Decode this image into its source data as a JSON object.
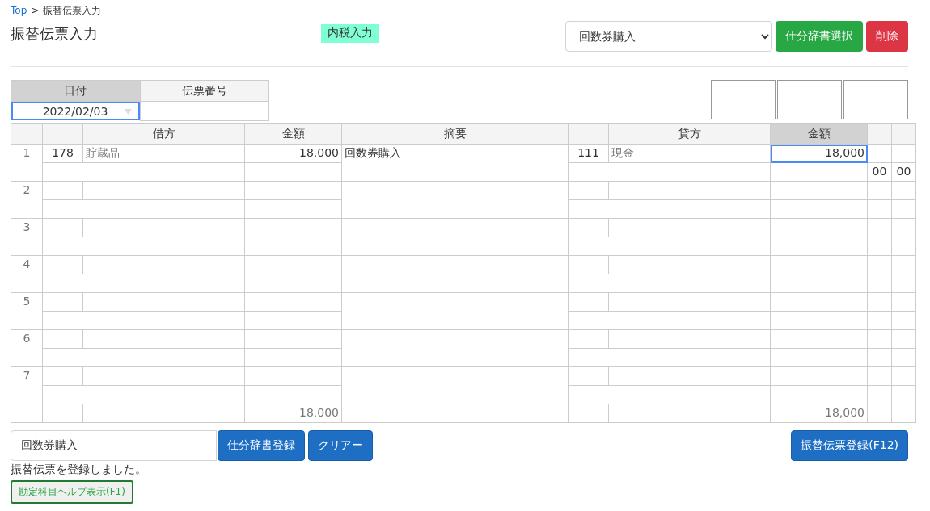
{
  "breadcrumb": {
    "link": "Top",
    "separator": ">",
    "current": "振替伝票入力"
  },
  "title": "振替伝票入力",
  "tax_badge": "内税入力",
  "dictionary_select": {
    "value": "回数券購入"
  },
  "header_buttons": [
    {
      "label": "仕分辞書選択",
      "kind": "success"
    },
    {
      "label": "削除",
      "kind": "danger"
    }
  ],
  "voucher_header": {
    "columns": [
      {
        "label": "日付",
        "highlighted": true
      },
      {
        "label": "伝票番号",
        "highlighted": false
      }
    ],
    "date": {
      "value": "2022/02/03",
      "focused": true
    }
  },
  "table": {
    "columns": [
      {
        "highlighted": false
      },
      {
        "highlighted": false
      },
      {
        "label": "借方",
        "highlighted": false
      },
      {
        "label": "金額",
        "highlighted": false
      },
      {
        "label": "摘要",
        "highlighted": false
      },
      {
        "highlighted": false
      },
      {
        "label": "貸方",
        "highlighted": false
      },
      {
        "label": "金額",
        "highlighted": true
      },
      {
        "highlighted": false
      },
      {
        "highlighted": false
      }
    ],
    "rows": [
      {
        "number": "1",
        "debit_code": "178",
        "debit_account": "貯蔵品",
        "debit_amount": "18,000",
        "summary": "回数券購入",
        "credit_code": "111",
        "credit_account": "現金",
        "credit_amount": "18,000",
        "credit_focused": true,
        "extra": [
          "00",
          "00"
        ]
      },
      {
        "number": "2",
        "credit_focused": false
      },
      {
        "number": "3",
        "credit_focused": false
      },
      {
        "number": "4",
        "credit_focused": false
      },
      {
        "number": "5",
        "credit_focused": false
      },
      {
        "number": "6",
        "credit_focused": false
      },
      {
        "number": "7",
        "credit_focused": false
      }
    ],
    "totals": {
      "debit": "18,000",
      "credit": "18,000"
    }
  },
  "dictionary_name": {
    "value": "回数券購入"
  },
  "footer_buttons": [
    {
      "label": "仕分辞書登録"
    },
    {
      "label": "クリアー"
    }
  ],
  "submit_button": "振替伝票登録(F12)",
  "message": "振替伝票を登録しました。",
  "help_button": "勘定科目ヘルプ表示(F1)"
}
